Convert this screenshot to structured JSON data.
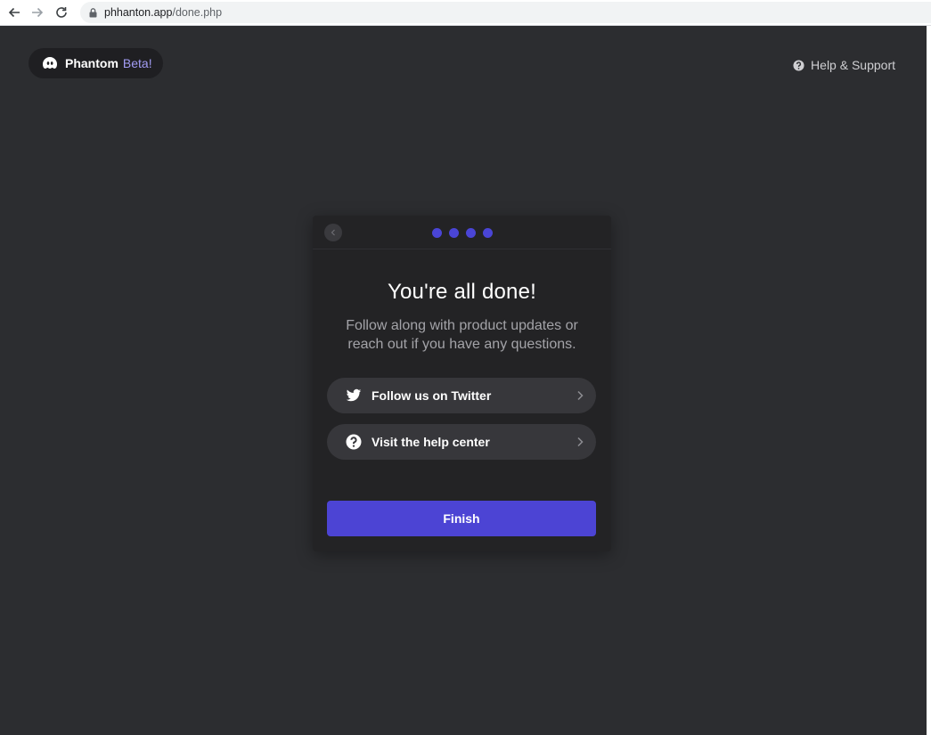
{
  "browser": {
    "url_host": "phhanton.app",
    "url_path": "/done.php"
  },
  "header": {
    "brand_name": "Phantom",
    "brand_tag": "Beta!",
    "help_label": "Help & Support"
  },
  "modal": {
    "step_count": 4,
    "title": "You're all done!",
    "subtitle": "Follow along with product updates or reach out if you have any questions.",
    "links": [
      {
        "label": "Follow us on Twitter",
        "icon": "twitter-icon"
      },
      {
        "label": "Visit the help center",
        "icon": "question-icon"
      }
    ],
    "finish_label": "Finish"
  },
  "colors": {
    "page_bg": "#2c2d30",
    "modal_bg": "#232325",
    "accent": "#4c44d4",
    "brand_tag": "#a29cf4"
  }
}
